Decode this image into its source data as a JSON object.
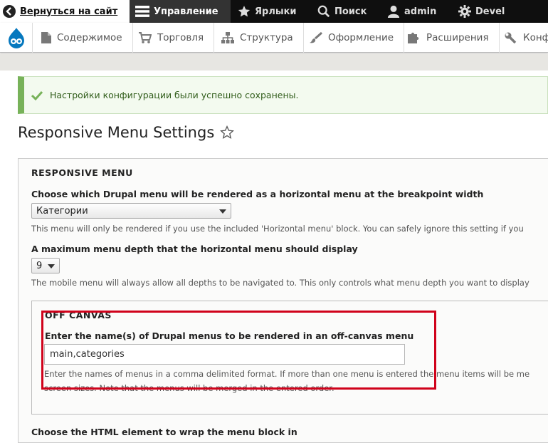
{
  "toolbar": {
    "back": "Вернуться на сайт",
    "manage": "Управление",
    "shortcuts": "Ярлыки",
    "search": "Поиск",
    "user": "admin",
    "devel": "Devel"
  },
  "tray": {
    "items": [
      "Содержимое",
      "Торговля",
      "Структура",
      "Оформление",
      "Расширения",
      "Конф"
    ]
  },
  "status": {
    "message": "Настройки конфигурации были успешно сохранены."
  },
  "page": {
    "title": "Responsive Menu Settings"
  },
  "form": {
    "legend": "RESPONSIVE MENU",
    "horizontal_label": "Choose which Drupal menu will be rendered as a horizontal menu at the breakpoint width",
    "horizontal_value": "Категории",
    "horizontal_desc": "This menu will only be rendered if you use the included 'Horizontal menu' block. You can safely ignore this setting if you",
    "depth_label": "A maximum menu depth that the horizontal menu should display",
    "depth_value": "9",
    "depth_desc": "The mobile menu will always allow all depths to be navigated to. This only controls what menu depth you want to display",
    "offcanvas": {
      "legend": "OFF CANVAS",
      "label": "Enter the name(s) of Drupal menus to be rendered in an off-canvas menu",
      "value": "main,categories",
      "desc_line1": "Enter the names of menus in a comma delimited format. If more than one menu is entered the menu items will be me",
      "desc_line2": "screen sizes. Note that the menus will be merged in the entered order."
    },
    "wrap_label": "Choose the HTML element to wrap the menu block in"
  },
  "colors": {
    "highlight": "#d0021b",
    "status_green": "#77b259"
  }
}
